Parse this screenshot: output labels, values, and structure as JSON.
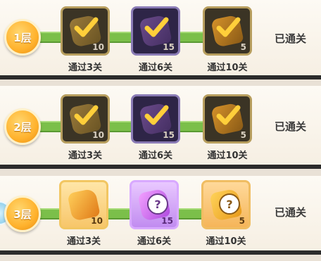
{
  "tiers": [
    {
      "badge": "1层",
      "status": "已通关",
      "rewards": [
        {
          "label": "通过3关",
          "count": "10",
          "icon": "check-icon"
        },
        {
          "label": "通过6关",
          "count": "15",
          "icon": "check-icon"
        },
        {
          "label": "通过10关",
          "count": "5",
          "icon": "check-icon"
        }
      ]
    },
    {
      "badge": "2层",
      "status": "已通关",
      "rewards": [
        {
          "label": "通过3关",
          "count": "10",
          "icon": "check-icon"
        },
        {
          "label": "通过6关",
          "count": "15",
          "icon": "check-icon"
        },
        {
          "label": "通过10关",
          "count": "5",
          "icon": "check-icon"
        }
      ]
    },
    {
      "badge": "3层",
      "status": "已通关",
      "rewards": [
        {
          "label": "通过3关",
          "count": "10",
          "icon": "ore-icon"
        },
        {
          "label": "通过6关",
          "count": "15",
          "icon": "question-icon"
        },
        {
          "label": "通过10关",
          "count": "5",
          "icon": "question-icon"
        }
      ]
    }
  ],
  "colors": {
    "track": "#7bbf4a",
    "badge": "#ffb22d",
    "check": "#ffcf3a"
  }
}
